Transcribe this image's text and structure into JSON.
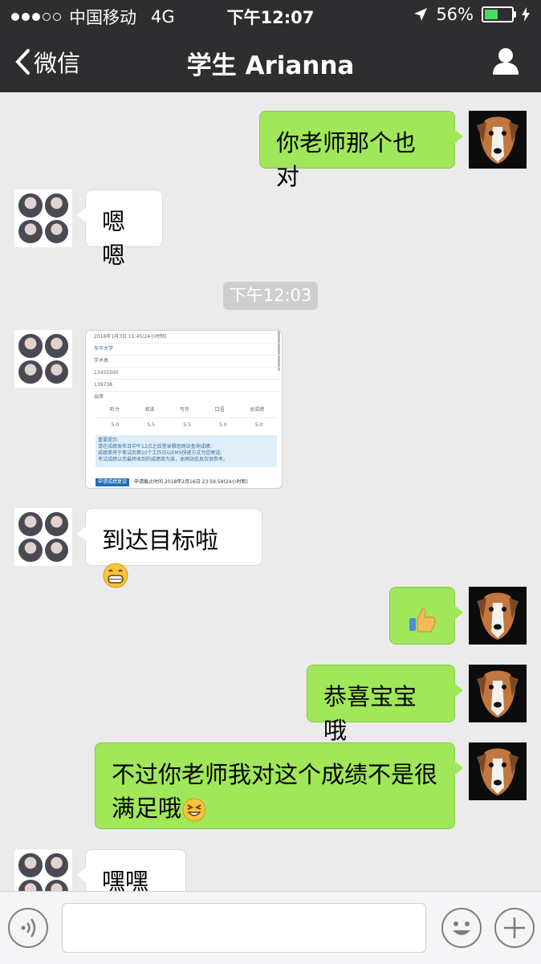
{
  "status_bar": {
    "carrier": "中国移动",
    "network": "4G",
    "time": "下午12:07",
    "battery_percent": "56%",
    "battery_level": 0.56
  },
  "nav": {
    "back_label": "微信",
    "title": "学生 Arianna"
  },
  "chat": {
    "timestamp": "下午12:03",
    "messages": [
      {
        "from": "me",
        "text": "你老师那个也对"
      },
      {
        "from": "them",
        "text": "嗯嗯"
      },
      {
        "from": "them",
        "type": "image"
      },
      {
        "from": "them",
        "text": "到达目标啦",
        "emoji": "grin-emoji"
      },
      {
        "from": "me",
        "type": "sticker",
        "emoji": "thumbs-up-emoji"
      },
      {
        "from": "me",
        "text": "恭喜宝宝哦"
      },
      {
        "from": "me",
        "text_line1": "不过你老师我对这个成绩不是很",
        "text_line2": "满足哦",
        "emoji": "squint-emoji"
      },
      {
        "from": "them",
        "text": "嘿嘿嘿"
      }
    ]
  },
  "score_screenshot": {
    "date": "2018年1月3日 15:45(24小时制)",
    "school": "东华大学",
    "type": "学术类",
    "id1": "13455500",
    "id2": "139738",
    "status": "出席",
    "headers": [
      "听力",
      "阅读",
      "写作",
      "口语",
      "总成绩"
    ],
    "scores": [
      "5.0",
      "5.5",
      "5.5",
      "5.0",
      "5.0"
    ],
    "tip_title": "重要提示:",
    "tip1": "请在成绩发布日中午12点之后登录雅思网站查询成绩;",
    "tip2": "成绩单将于笔试后第10个工作日以EMS快递方式为您寄送;",
    "tip3": "考试成绩以您最终收到的成绩单为准，本网站信息仅供参考。",
    "button": "申请成绩复议",
    "deadline": "申请截止时间 2018年2月16日 23:59:59(24小时制)"
  },
  "colors": {
    "bar_bg": "#2e2e30",
    "chat_bg": "#ebebeb",
    "my_bubble": "#a0e759",
    "their_bubble": "#ffffff"
  }
}
